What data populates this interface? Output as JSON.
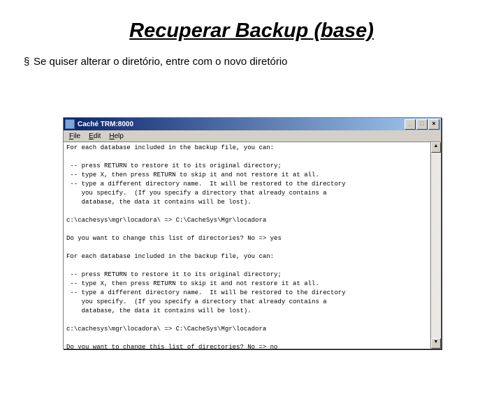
{
  "title": "Recuperar Backup (base)",
  "bullet_glyph": "§",
  "bullet_text": "Se quiser alterar o diretório, entre com o novo diretório",
  "window": {
    "title": "Caché TRM:8000",
    "buttons": {
      "min": "_",
      "max": "□",
      "close": "×"
    },
    "menu": {
      "file": "File",
      "edit": "Edit",
      "help": "Help"
    },
    "scroll": {
      "up": "▲",
      "down": "▼"
    },
    "terminal": "For each database included in the backup file, you can:\n\n -- press RETURN to restore it to its original directory;\n -- type X, then press RETURN to skip it and not restore it at all.\n -- type a different directory name.  It will be restored to the directory\n    you specify.  (If you specify a directory that already contains a\n    database, the data it contains will be lost).\n\nc:\\cachesys\\mgr\\locadora\\ => C:\\CacheSys\\Mgr\\locadora\n\nDo you want to change this list of directories? No => yes\n\nFor each database included in the backup file, you can:\n\n -- press RETURN to restore it to its original directory;\n -- type X, then press RETURN to skip it and not restore it at all.\n -- type a different directory name.  It will be restored to the directory\n    you specify.  (If you specify a directory that already contains a\n    database, the data it contains will be lost).\n\nc:\\cachesys\\mgr\\locadora\\ => C:\\CacheSys\\Mgr\\locadora\n\nDo you want to change this list of directories? No => no"
  }
}
